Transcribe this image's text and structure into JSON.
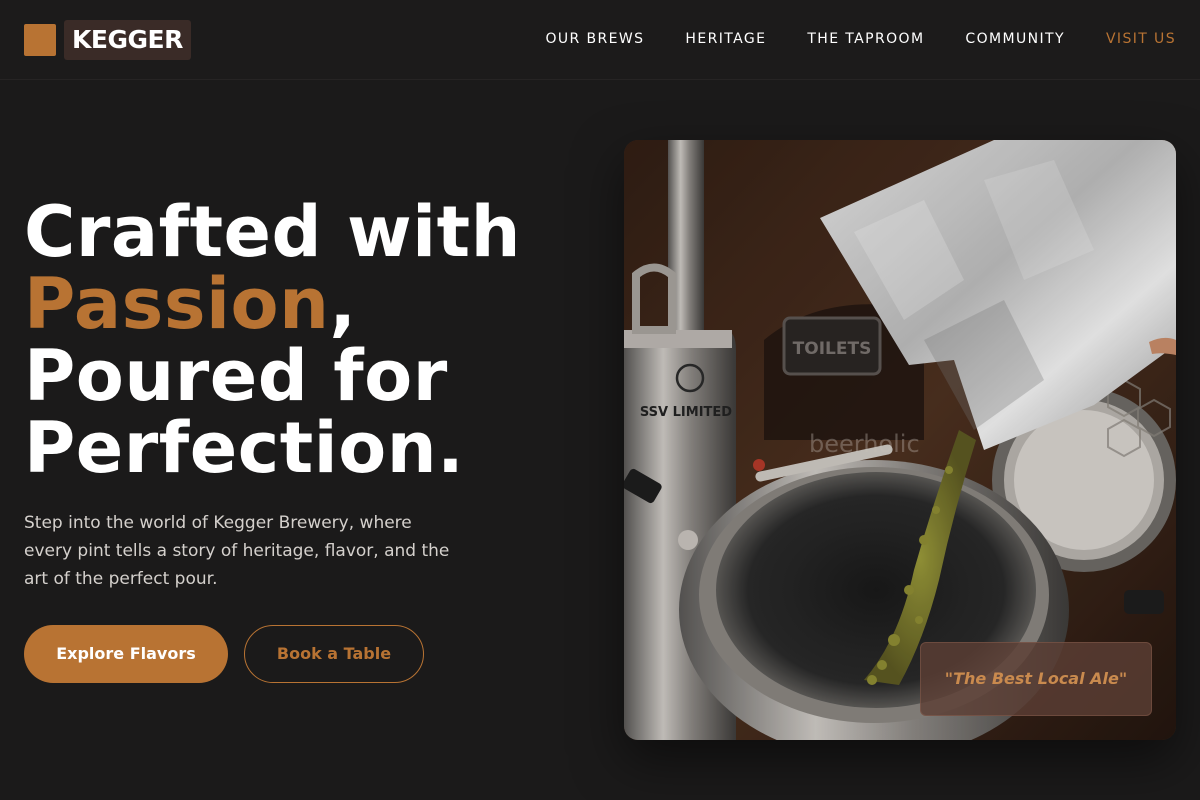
{
  "brand": {
    "name": "KEGGER"
  },
  "nav": {
    "items": [
      "OUR BREWS",
      "HERITAGE",
      "THE TAPROOM",
      "COMMUNITY"
    ],
    "cta": "VISIT US"
  },
  "hero": {
    "line1": "Crafted with",
    "accent": "Passion",
    "comma": ",",
    "line3": "Poured for",
    "line4": "Perfection.",
    "subtext": "Step into the world of Kegger Brewery, where every pint tells a story of heritage, flavor, and the art of the perfect pour.",
    "primary_button": "Explore Flavors",
    "secondary_button": "Book a Table",
    "quote": "\"The Best Local Ale\"",
    "photo_sign": "TOILETS",
    "photo_tank_label": "SSV LIMITED",
    "photo_watermark": "beerholic"
  },
  "colors": {
    "accent": "#b87333",
    "background": "#1b1a1a"
  }
}
